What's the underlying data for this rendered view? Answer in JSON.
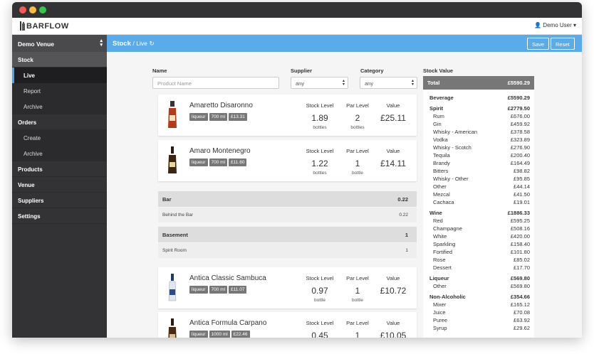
{
  "app": {
    "brand": "BARFLOW",
    "user": "Demo User ▾"
  },
  "sidebar": {
    "venue": "Demo Venue",
    "sections": [
      {
        "label": "Stock",
        "subs": [
          "Live",
          "Report",
          "Archive"
        ]
      },
      {
        "label": "Orders",
        "subs": [
          "Create",
          "Archive"
        ]
      },
      {
        "label": "Products"
      },
      {
        "label": "Venue"
      },
      {
        "label": "Suppliers"
      },
      {
        "label": "Settings"
      }
    ]
  },
  "header": {
    "title": "Stock",
    "crumb": "/ Live",
    "save": "Save",
    "reset": "Reset"
  },
  "filters": {
    "name_label": "Name",
    "name_placeholder": "Product Name",
    "supplier_label": "Supplier",
    "supplier_value": "any",
    "category_label": "Category",
    "category_value": "any"
  },
  "columns": {
    "stock": "Stock Level",
    "par": "Par Level",
    "value": "Value"
  },
  "products": [
    {
      "name": "Amaretto Disaronno",
      "tags": [
        "liqueur",
        "700 ml",
        "£13.31"
      ],
      "stock": "1.89",
      "stock_unit": "bottles",
      "par": "2",
      "par_unit": "bottles",
      "value": "£25.11"
    },
    {
      "name": "Amaro Montenegro",
      "tags": [
        "liqueur",
        "700 ml",
        "£11.60"
      ],
      "stock": "1.22",
      "stock_unit": "bottles",
      "par": "1",
      "par_unit": "bottle",
      "value": "£14.11"
    },
    {
      "name": "Antica Classic Sambuca",
      "tags": [
        "liqueur",
        "700 ml",
        "£11.07"
      ],
      "stock": "0.97",
      "stock_unit": "bottle",
      "par": "1",
      "par_unit": "bottle",
      "value": "£10.72"
    },
    {
      "name": "Antica Formula Carpano",
      "tags": [
        "liqueur",
        "1000 ml",
        "£22.46"
      ],
      "stock": "0.45",
      "stock_unit": "",
      "par": "1",
      "par_unit": "",
      "value": "£10.05"
    }
  ],
  "locations": [
    {
      "name": "Bar",
      "qty": "0.22",
      "rows": [
        {
          "name": "Behind the Bar",
          "qty": "0.22"
        }
      ]
    },
    {
      "name": "Basement",
      "qty": "1",
      "rows": [
        {
          "name": "Spirit Room",
          "qty": "1"
        }
      ]
    }
  ],
  "stock_value": {
    "label": "Stock Value",
    "total_label": "Total",
    "total": "£5590.29",
    "rows": [
      {
        "kind": "grp",
        "name": "Beverage",
        "value": "£5590.29"
      },
      {
        "kind": "cat",
        "name": "Spirit",
        "value": "£2779.50"
      },
      {
        "kind": "item",
        "name": "Rum",
        "value": "£676.00"
      },
      {
        "kind": "item",
        "name": "Gin",
        "value": "£459.92"
      },
      {
        "kind": "item",
        "name": "Whisky - American",
        "value": "£378.58"
      },
      {
        "kind": "item",
        "name": "Vodka",
        "value": "£323.89"
      },
      {
        "kind": "item",
        "name": "Whisky - Scotch",
        "value": "£276.90"
      },
      {
        "kind": "item",
        "name": "Tequila",
        "value": "£200.40"
      },
      {
        "kind": "item",
        "name": "Brandy",
        "value": "£164.49"
      },
      {
        "kind": "item",
        "name": "Bitters",
        "value": "£98.82"
      },
      {
        "kind": "item",
        "name": "Whisky - Other",
        "value": "£95.85"
      },
      {
        "kind": "item",
        "name": "Other",
        "value": "£44.14"
      },
      {
        "kind": "item",
        "name": "Mezcal",
        "value": "£41.50"
      },
      {
        "kind": "item",
        "name": "Cachaca",
        "value": "£19.01"
      },
      {
        "kind": "cat",
        "name": "Wine",
        "value": "£1886.33"
      },
      {
        "kind": "item",
        "name": "Red",
        "value": "£595.25"
      },
      {
        "kind": "item",
        "name": "Champagne",
        "value": "£508.16"
      },
      {
        "kind": "item",
        "name": "White",
        "value": "£420.00"
      },
      {
        "kind": "item",
        "name": "Sparkling",
        "value": "£158.40"
      },
      {
        "kind": "item",
        "name": "Fortified",
        "value": "£101.80"
      },
      {
        "kind": "item",
        "name": "Rose",
        "value": "£85.02"
      },
      {
        "kind": "item",
        "name": "Dessert",
        "value": "£17.70"
      },
      {
        "kind": "cat",
        "name": "Liqueur",
        "value": "£569.80"
      },
      {
        "kind": "item",
        "name": "Other",
        "value": "£569.80"
      },
      {
        "kind": "cat",
        "name": "Non-Alcoholic",
        "value": "£354.66"
      },
      {
        "kind": "item",
        "name": "Mixer",
        "value": "£165.12"
      },
      {
        "kind": "item",
        "name": "Juice",
        "value": "£70.08"
      },
      {
        "kind": "item",
        "name": "Puree",
        "value": "£63.92"
      },
      {
        "kind": "item",
        "name": "Syrup",
        "value": "£29.62"
      }
    ]
  },
  "colors": {
    "accent": "#5aabea",
    "sidebar": "#333335",
    "tag": "#777777"
  }
}
